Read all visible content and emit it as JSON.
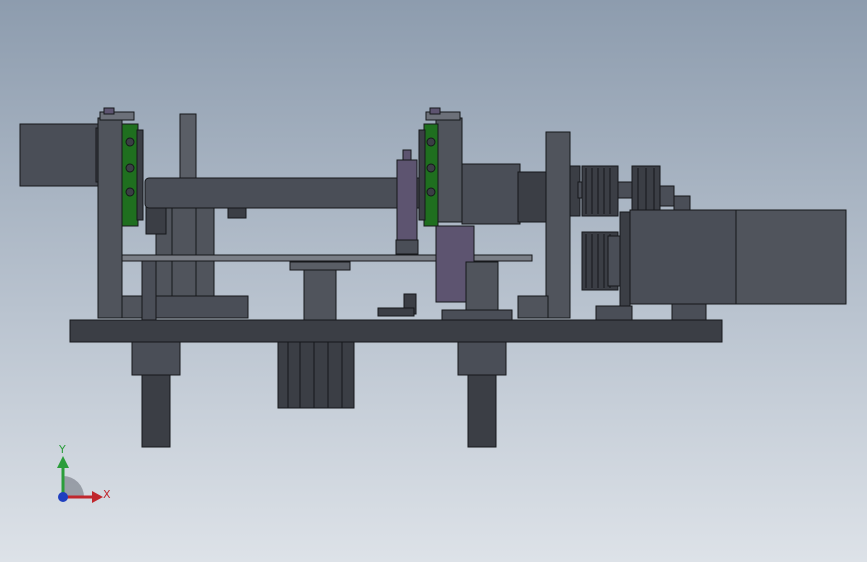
{
  "view": {
    "background_top": "#8d9cae",
    "background_bottom": "#dde2e8"
  },
  "colors": {
    "steel_dark": "#3b3e45",
    "steel_mid": "#50545c",
    "steel_light": "#6c7079",
    "motor_body": "#4a4e57",
    "roller_green": "#1f6f1f",
    "purple_part": "#5d5470",
    "outline": "#15171a"
  },
  "triad": {
    "x_label": "X",
    "y_label": "Y",
    "x_color": "#c0272d",
    "y_color": "#2a9d3a",
    "z_color": "#1f3fbf"
  }
}
